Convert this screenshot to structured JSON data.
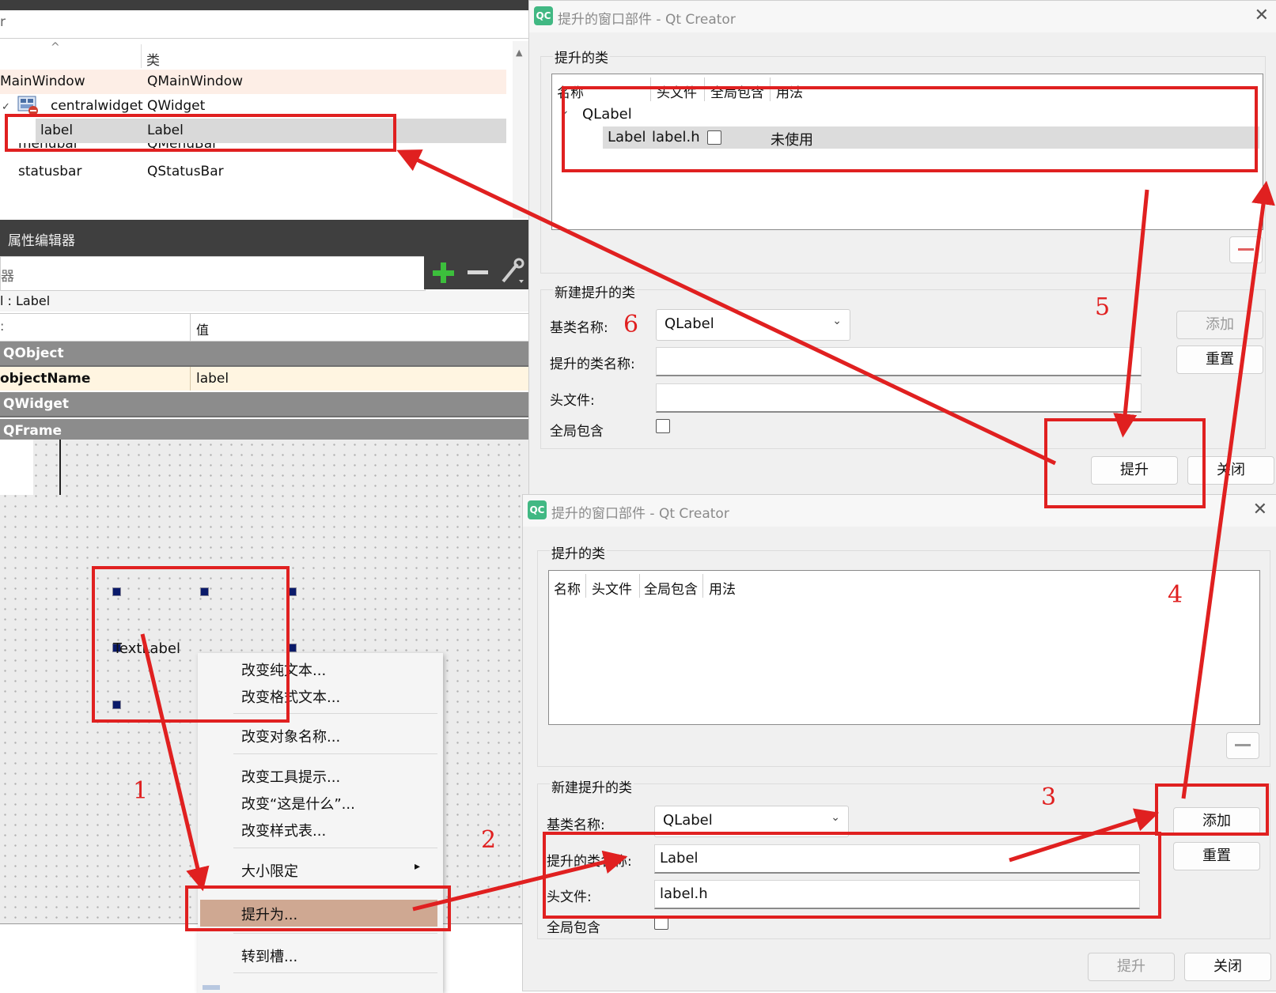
{
  "object_inspector": {
    "filter_text": "r",
    "sort_indicator": "^",
    "col_class": "类",
    "rows": [
      {
        "name": "MainWindow",
        "class": "QMainWindow"
      },
      {
        "name": "centralwidget",
        "class": "QWidget"
      },
      {
        "name": "label",
        "class": "Label"
      },
      {
        "name": "menubar",
        "class": "QMenuBar"
      },
      {
        "name": "statusbar",
        "class": "QStatusBar"
      }
    ]
  },
  "property_editor": {
    "title": "属性编辑器",
    "filter_text": "器",
    "selection": "l : Label",
    "col_value": "值",
    "groups": {
      "qobject": "QObject",
      "qwidget": "QWidget",
      "qframe": "QFrame"
    },
    "object_name_key": "objectName",
    "object_name_value": "label"
  },
  "canvas": {
    "label_text": "TextLabel"
  },
  "context_menu": {
    "items": [
      "改变纯文本...",
      "改变格式文本...",
      "改变对象名称...",
      "改变工具提示...",
      "改变“这是什么”...",
      "改变样式表...",
      "大小限定",
      "提升为...",
      "转到槽..."
    ],
    "submenu_arrow": "▸"
  },
  "dialog_top": {
    "icon": "QC",
    "title": "提升的窗口部件 - Qt Creator",
    "promoted_group": "提升的类",
    "columns": [
      "名称",
      "头文件",
      "全局包含",
      "用法"
    ],
    "tree_parent": "QLabel",
    "tree_child": {
      "name": "Label",
      "header": "label.h",
      "usage": "未使用"
    },
    "new_group": "新建提升的类",
    "base_label": "基类名称:",
    "base_value": "QLabel",
    "class_label": "提升的类名称:",
    "class_value": "",
    "header_label": "头文件:",
    "header_value": "",
    "global_label": "全局包含",
    "add_button": "添加",
    "reset_button": "重置",
    "promote_button": "提升",
    "close_button": "关闭"
  },
  "dialog_bottom": {
    "icon": "QC",
    "title": "提升的窗口部件 - Qt Creator",
    "promoted_group": "提升的类",
    "columns": [
      "名称",
      "头文件",
      "全局包含",
      "用法"
    ],
    "new_group": "新建提升的类",
    "base_label": "基类名称:",
    "base_value": "QLabel",
    "class_label": "提升的类名称:",
    "class_value": "Label",
    "header_label": "头文件:",
    "header_value": "label.h",
    "global_label": "全局包含",
    "add_button": "添加",
    "reset_button": "重置",
    "promote_button": "提升",
    "close_button": "关闭"
  },
  "annotations": {
    "color": "#e02020",
    "steps": [
      "1",
      "2",
      "3",
      "4",
      "5",
      "6"
    ]
  }
}
